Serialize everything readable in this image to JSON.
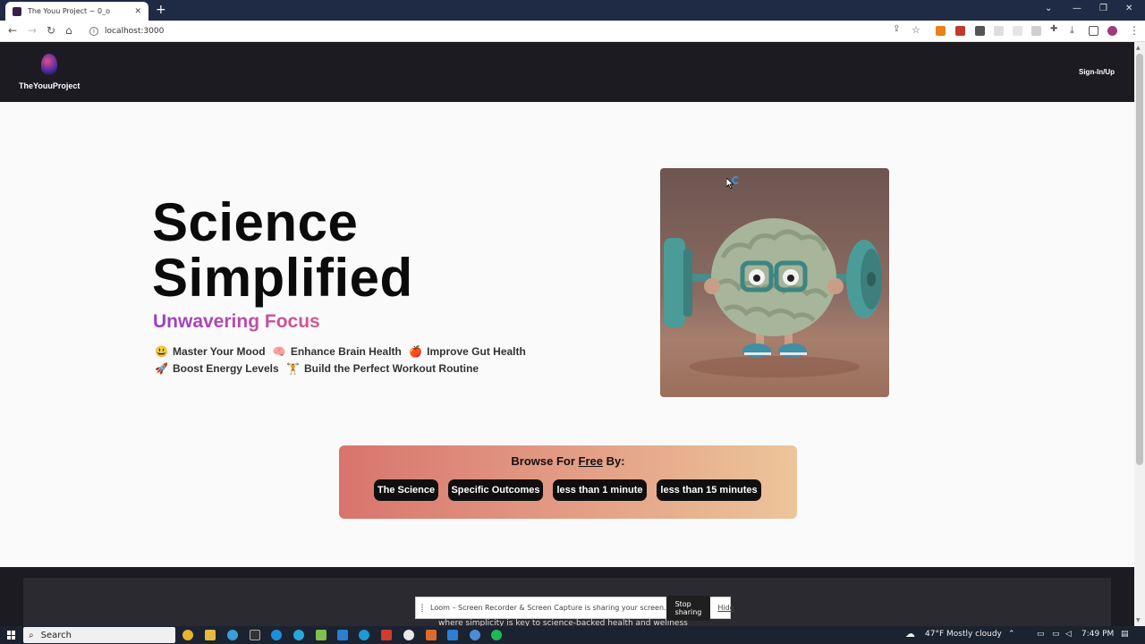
{
  "browser": {
    "tab_title": "The Youu Project ~ 0_o",
    "tab_close": "✕",
    "new_tab": "+",
    "url": "localhost:3000",
    "minimize": "—",
    "restore": "❐",
    "close": "✕",
    "collapse": "⌄"
  },
  "header": {
    "logo_text": "TheYouuProject",
    "signin": "Sign-In/Up"
  },
  "hero": {
    "title_line1": "Science",
    "title_line2": "Simplified",
    "subtitle": "Unwavering Focus",
    "features_row1": [
      {
        "emoji": "😃",
        "label": "Master Your Mood"
      },
      {
        "emoji": "🧠",
        "label": "Enhance Brain Health"
      },
      {
        "emoji": "🍎",
        "label": "Improve Gut Health"
      }
    ],
    "features_row2": [
      {
        "emoji": "🚀",
        "label": "Boost Energy Levels"
      },
      {
        "emoji": "🏋",
        "label": "Build the Perfect Workout Routine"
      }
    ]
  },
  "browse": {
    "title_prefix": "Browse For ",
    "title_free": "Free",
    "title_suffix": " By:",
    "chips": [
      "The Science",
      "Specific Outcomes",
      "less than 1 minute",
      "less than 15 minutes"
    ]
  },
  "footer": {
    "partial_text": "where simplicity is key to science-backed health and wellness"
  },
  "loom": {
    "message": "Loom – Screen Recorder & Screen Capture is sharing your screen.",
    "stop": "Stop sharing",
    "hide": "Hide"
  },
  "taskbar": {
    "search": "Search",
    "temperature": "47°F",
    "weather": "Mostly cloudy",
    "time": "7:49 PM"
  }
}
